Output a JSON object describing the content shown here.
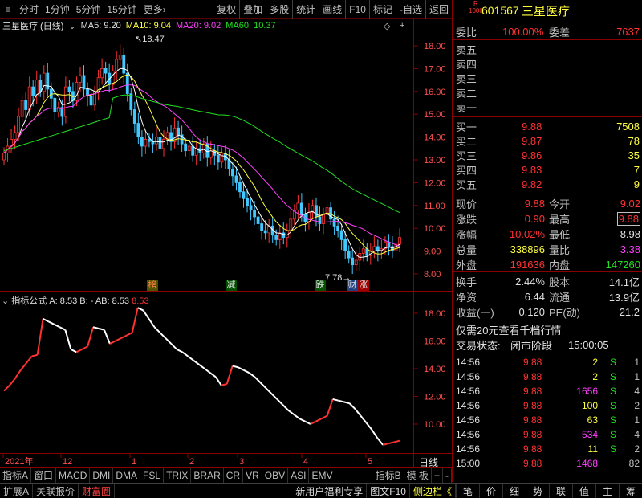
{
  "toolbar": {
    "menu_icon": "≡",
    "period_tabs": [
      "分时",
      "1分钟",
      "5分钟",
      "15分钟",
      "更多›"
    ],
    "actions": [
      "复权",
      "叠加",
      "多股",
      "统计",
      "画线",
      "F10",
      "标记",
      "-自选",
      "返回"
    ]
  },
  "chart_header": {
    "stock": "三星医疗 (日线)",
    "ma5": "MA5: 9.20",
    "ma10": "MA10: 9.04",
    "ma20": "MA20: 9.02",
    "ma60": "MA60: 10.37",
    "diamond": "◇",
    "plus": "+"
  },
  "price_axis": [
    "18.00",
    "17.00",
    "16.00",
    "15.00",
    "14.00",
    "13.00",
    "12.00",
    "11.00",
    "10.00",
    "9.00",
    "8.00"
  ],
  "price_marks": {
    "high": "18.47",
    "low": "7.78"
  },
  "event_tags": [
    "榜",
    "减",
    "跌",
    "财",
    "涨"
  ],
  "indicator_header": {
    "name": "指标公式",
    "a": "A: 8.53",
    "b": "B: -",
    "ab": "AB: 8.53",
    "last": "8.53"
  },
  "indicator_axis": [
    "18.00",
    "16.00",
    "14.00",
    "12.00",
    "10.00"
  ],
  "date_axis": {
    "labels": [
      "2021年",
      "12",
      "1",
      "2",
      "3",
      "4",
      "5"
    ],
    "period": "日线"
  },
  "indicator_tabs": [
    "指标A",
    "窗口",
    "MACD",
    "DMI",
    "DMA",
    "FSL",
    "TRIX",
    "BRAR",
    "CR",
    "VR",
    "OBV",
    "ASI",
    "EMV",
    "指标B",
    "模 板",
    "+",
    "-"
  ],
  "bottom_tabs": [
    "扩展A",
    "关联报价",
    "财富圈"
  ],
  "bottom_right": [
    "新用户福利专享",
    "图文F10",
    "侧边栏《"
  ],
  "quote_tabs": [
    "笔",
    "价",
    "细",
    "势",
    "联",
    "值",
    "主",
    "筹"
  ],
  "quote": {
    "code": "601567",
    "name": "三星医疗",
    "badge_r": "R",
    "badge_num": "1000",
    "weibi_label": "委比",
    "weibi": "100.00%",
    "weicha_label": "委差",
    "weicha": "7637",
    "sell_labels": [
      "卖五",
      "卖四",
      "卖三",
      "卖二",
      "卖一"
    ],
    "buys": [
      {
        "label": "买一",
        "price": "9.88",
        "vol": "7508"
      },
      {
        "label": "买二",
        "price": "9.87",
        "vol": "78"
      },
      {
        "label": "买三",
        "price": "9.86",
        "vol": "35"
      },
      {
        "label": "买四",
        "price": "9.83",
        "vol": "7"
      },
      {
        "label": "买五",
        "price": "9.82",
        "vol": "9"
      }
    ],
    "stats": [
      {
        "l1": "现价",
        "v1": "9.88",
        "l2": "今开",
        "v2": "9.02"
      },
      {
        "l1": "涨跌",
        "v1": "0.90",
        "l2": "最高",
        "v2": "9.88"
      },
      {
        "l1": "涨幅",
        "v1": "10.02%",
        "l2": "最低",
        "v2": "8.98"
      },
      {
        "l1": "总量",
        "v1": "338896",
        "l2": "量比",
        "v2": "3.38"
      },
      {
        "l1": "外盘",
        "v1": "191636",
        "l2": "内盘",
        "v2": "147260"
      }
    ],
    "stats2": [
      {
        "l1": "换手",
        "v1": "2.44%",
        "l2": "股本",
        "v2": "14.1亿"
      },
      {
        "l1": "净资",
        "v1": "6.44",
        "l2": "流通",
        "v2": "13.9亿"
      },
      {
        "l1": "收益(一)",
        "v1": "0.120",
        "l2": "PE(动)",
        "v2": "21.2"
      }
    ],
    "promo": "仅需20元查看千档行情",
    "status_label": "交易状态:",
    "status": "闭市阶段",
    "status_time": "15:00:05",
    "ticks": [
      {
        "t": "14:56",
        "p": "9.88",
        "v": "2",
        "s": "S",
        "n": "1"
      },
      {
        "t": "14:56",
        "p": "9.88",
        "v": "2",
        "s": "S",
        "n": "1"
      },
      {
        "t": "14:56",
        "p": "9.88",
        "v": "1656",
        "s": "S",
        "n": "4"
      },
      {
        "t": "14:56",
        "p": "9.88",
        "v": "100",
        "s": "S",
        "n": "2"
      },
      {
        "t": "14:56",
        "p": "9.88",
        "v": "63",
        "s": "S",
        "n": "1"
      },
      {
        "t": "14:56",
        "p": "9.88",
        "v": "534",
        "s": "S",
        "n": "4"
      },
      {
        "t": "14:56",
        "p": "9.88",
        "v": "11",
        "s": "S",
        "n": "2"
      },
      {
        "t": "15:00",
        "p": "9.88",
        "v": "1468",
        "s": "",
        "n": "82"
      }
    ]
  },
  "colors": {
    "up": "#ff3232",
    "down": "#40c8ff",
    "ma5": "#ffffff",
    "ma10": "#ffff40",
    "ma20": "#ff40ff",
    "ma60": "#20e020",
    "grid": "#8a0000"
  }
}
